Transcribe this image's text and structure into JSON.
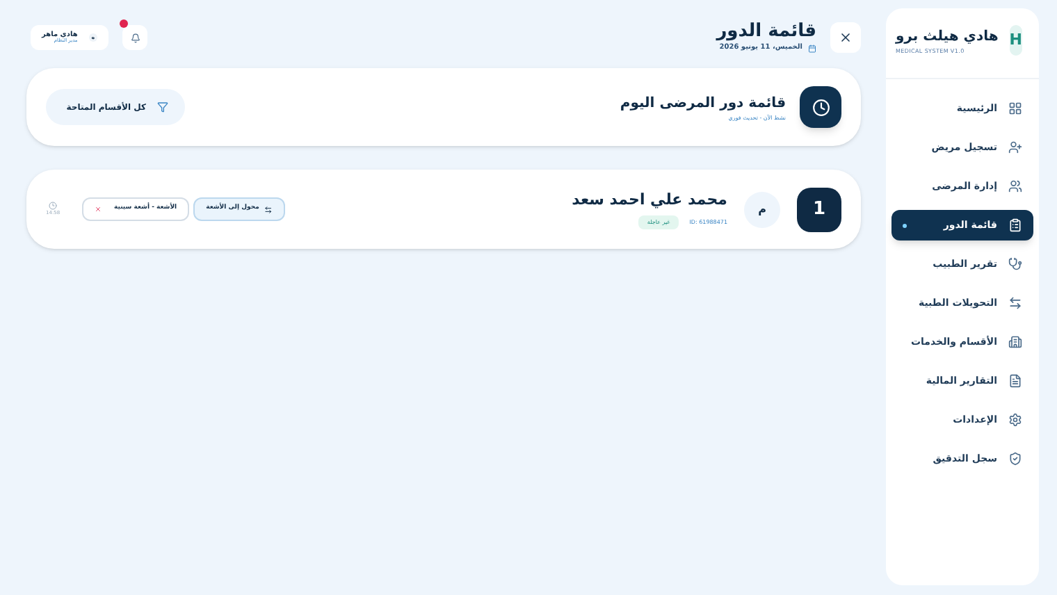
{
  "header": {
    "title": "قائمة الدور",
    "date": "الخميس، 11 يونيو 2026",
    "user": {
      "name": "هادي ماهر",
      "role": "مدير النظام",
      "initial": "ه"
    },
    "notifications": {
      "unread": true
    }
  },
  "queue_card": {
    "title": "قائمة دور المرضى اليوم",
    "subtitle": "نشط الآن - تحديث فوري",
    "filter": "كل الأقسام المتاحة"
  },
  "patients": [
    {
      "number": "1",
      "initial": "م",
      "name": "محمد علي احمد سعد",
      "id": "ID: 61988471",
      "status": "غير عاجلة",
      "transfer": "محول إلى الأشعة",
      "department": "الأشعة - أشعة سينية",
      "time": "14:58"
    }
  ],
  "sidebar": {
    "logo": "H",
    "brand": "هادي هيلث برو",
    "tagline": "MEDICAL SYSTEM V1.0",
    "items": [
      {
        "label": "الرئيسية",
        "selected": false
      },
      {
        "label": "تسجيل مريض",
        "selected": false
      },
      {
        "label": "إدارة المرضى",
        "selected": false
      },
      {
        "label": "قائمة الدور",
        "selected": true
      },
      {
        "label": "تقرير الطبيب",
        "selected": false
      },
      {
        "label": "التحويلات الطبية",
        "selected": false
      },
      {
        "label": "الأقسام والخدمات",
        "selected": false
      },
      {
        "label": "التقارير المالية",
        "selected": false
      },
      {
        "label": "الإعدادات",
        "selected": false
      },
      {
        "label": "سجل التدقيق",
        "selected": false
      }
    ]
  }
}
